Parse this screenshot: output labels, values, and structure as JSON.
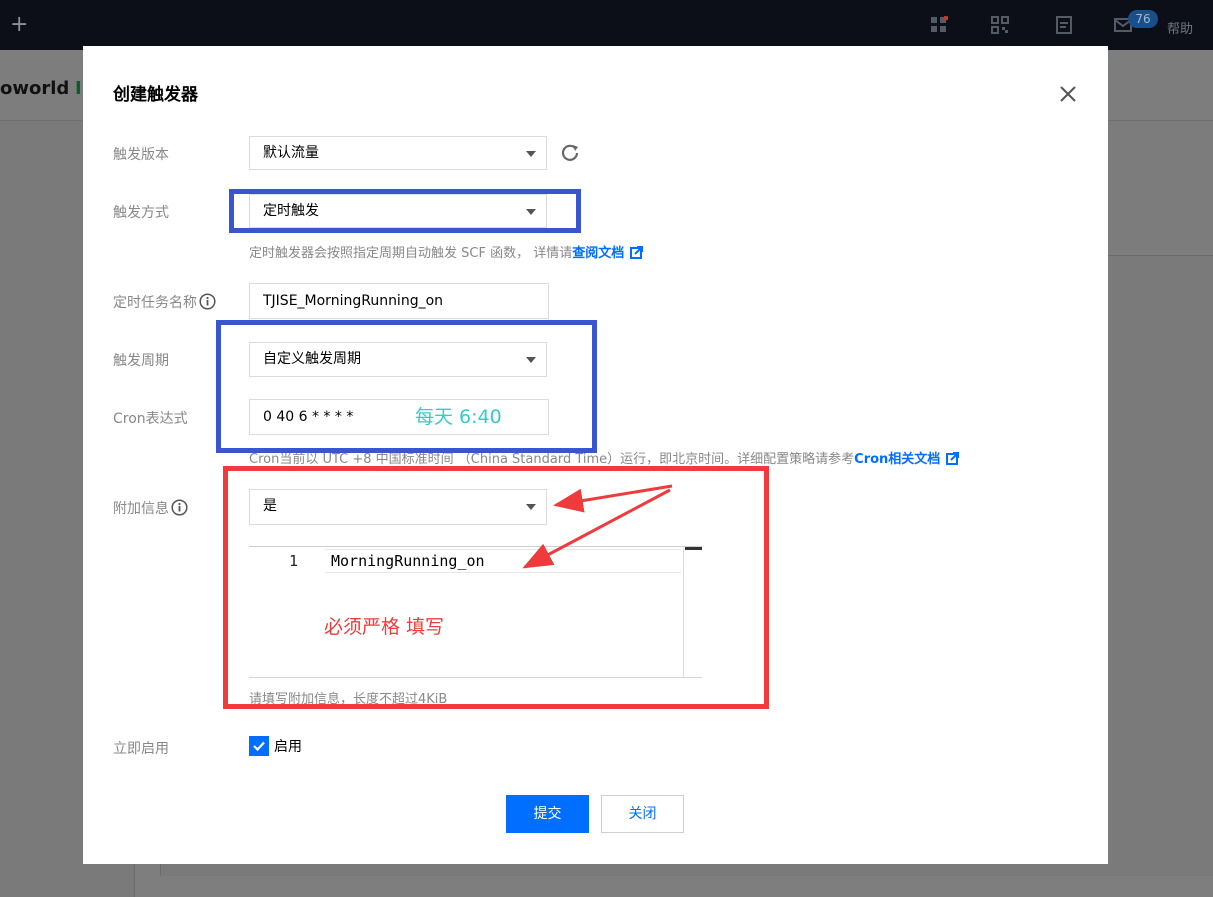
{
  "topbar": {
    "plus": "+",
    "mail_count": "76",
    "help": "帮助"
  },
  "background": {
    "title": "oworld",
    "title_suffix": "I"
  },
  "modal": {
    "title": "创建触发器",
    "fields": {
      "trigger_version": {
        "label": "触发版本",
        "value": "默认流量"
      },
      "trigger_method": {
        "label": "触发方式",
        "value": "定时触发",
        "help_text": "定时触发器会按照指定周期自动触发 SCF 函数， 详情请",
        "help_link": "查阅文档"
      },
      "task_name": {
        "label": "定时任务名称",
        "value": "TJISE_MorningRunning_on"
      },
      "trigger_period": {
        "label": "触发周期",
        "value": "自定义触发周期"
      },
      "cron": {
        "label": "Cron表达式",
        "value": "0 40 6 * * * *",
        "help_text": "Cron当前以 UTC +8 中国标准时间 （China Standard Time）运行，即北京时间。详细配置策略请参考",
        "help_link": "Cron相关文档"
      },
      "extra_info": {
        "label": "附加信息",
        "value": "是",
        "editor_line": "1",
        "editor_code": "MorningRunning_on",
        "help_text": "请填写附加信息，长度不超过4KiB"
      },
      "enable_now": {
        "label": "立即启用",
        "checkbox_label": "启用",
        "checked": true
      }
    },
    "submit_label": "提交",
    "close_label": "关闭"
  },
  "annotations": {
    "cron_note": "每天 6:40",
    "extra_note": "必须严格 填写",
    "blue": "#3a55d0",
    "red": "#ef3b3b",
    "cyan": "#33cccc"
  },
  "colors": {
    "primary": "#006eff",
    "topbar": "#0c0f17",
    "overlay": "#7e7e7e"
  }
}
